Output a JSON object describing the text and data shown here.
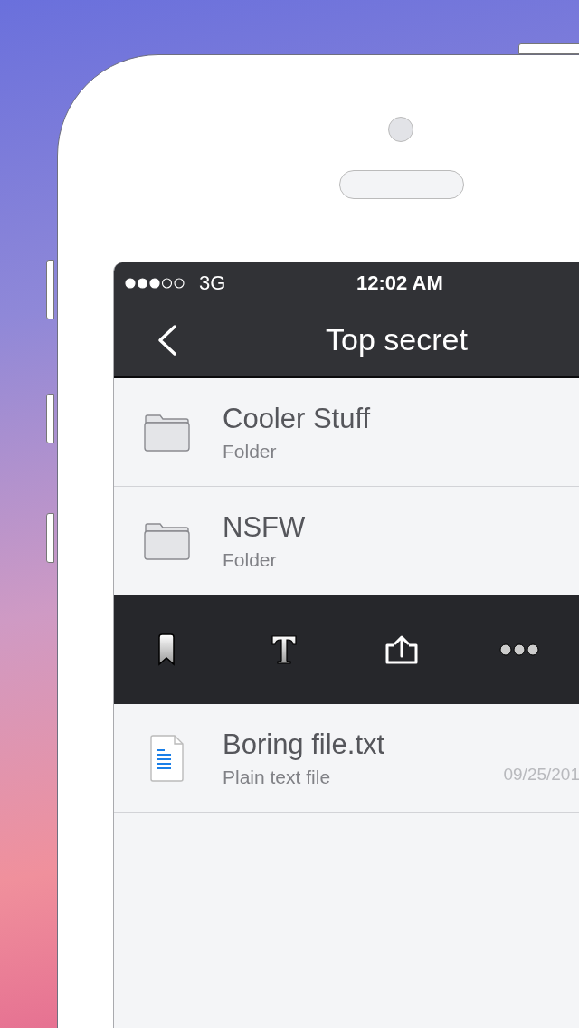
{
  "status_bar": {
    "carrier": "3G",
    "time": "12:02 AM"
  },
  "nav": {
    "title": "Top secret"
  },
  "rows": [
    {
      "kind": "folder",
      "title": "Cooler Stuff",
      "subtitle": "Folder"
    },
    {
      "kind": "folder",
      "title": "NSFW",
      "subtitle": "Folder"
    },
    {
      "kind": "actions"
    },
    {
      "kind": "file",
      "title": "Boring file.txt",
      "subtitle": "Plain text file",
      "date": "09/25/201"
    }
  ]
}
